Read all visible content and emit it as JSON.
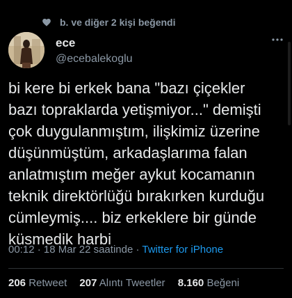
{
  "social_context": {
    "liked_by": "b. ve diğer 2 kişi beğendi"
  },
  "author": {
    "name": "ece",
    "handle": "@ecebalekoglu"
  },
  "tweet": {
    "text": "bi kere bi erkek bana \"bazı çiçekler\nbazı topraklarda yetişmiyor...\" demişti\nçok duygulanmıştım, ilişkimiz üzerine\ndüşünmüştüm, arkadaşlarıma falan\nanlatmıştım meğer aykut kocamanın\nteknik direktörlüğü bırakırken kurduğu\ncümleymiş.... biz erkeklere bir günde\nküsmedik harbi"
  },
  "meta": {
    "time": "00:12",
    "sep1": " · ",
    "date": "18 Mar 22 saatinde",
    "sep2": " · ",
    "source": "Twitter for iPhone"
  },
  "stats": {
    "retweets_count": "206",
    "retweets_label": "Retweet",
    "quotes_count": "207",
    "quotes_label": "Alıntı Tweetler",
    "likes_count": "8.160",
    "likes_label": "Beğeni"
  },
  "colors": {
    "background": "#000000",
    "text_primary": "#e7e9ea",
    "text_secondary": "#8b98a5",
    "link": "#1d9bf0"
  },
  "icons": {
    "social_context": "heart-icon",
    "more": "more-icon"
  }
}
